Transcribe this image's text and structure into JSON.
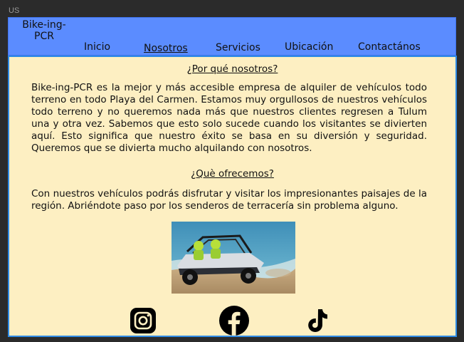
{
  "frame": {
    "label": "US"
  },
  "nav": {
    "brand": "Bike-ing-\nPCR",
    "links": [
      "Inicio",
      "Nosotros",
      "Servicios",
      "Ubicación",
      "Contactános"
    ],
    "active": "Nosotros"
  },
  "sections": [
    {
      "title": "¿Por qué nosotros?",
      "body": "Bike-ing-PCR es la mejor y más accesible empresa de alquiler de vehículos todo terreno en todo Playa del Carmen. Estamos muy orgullosos de nuestros vehículos todo terreno y no queremos nada más que nuestros clientes regresen a Tulum una y otra vez. Sabemos que esto solo sucede cuando los visitantes se divierten aquí. Esto significa que nuestro éxito se basa en su diversión y seguridad. Queremos que se divierta mucho alquilando con nosotros."
    },
    {
      "title": "¿Què ofrecemos?",
      "body": "Con nuestros vehículos podrás disfrutar y visitar los impresionantes paisajes de la región. Abriéndote paso por los senderos de terracería sin problema alguno."
    }
  ],
  "social": [
    "instagram-icon",
    "facebook-icon",
    "tiktok-icon"
  ],
  "colors": {
    "nav_bg": "#5b8cff",
    "content_bg": "#fdefc2",
    "content_border": "#2e8be6",
    "page_bg": "#2b2b2b"
  }
}
